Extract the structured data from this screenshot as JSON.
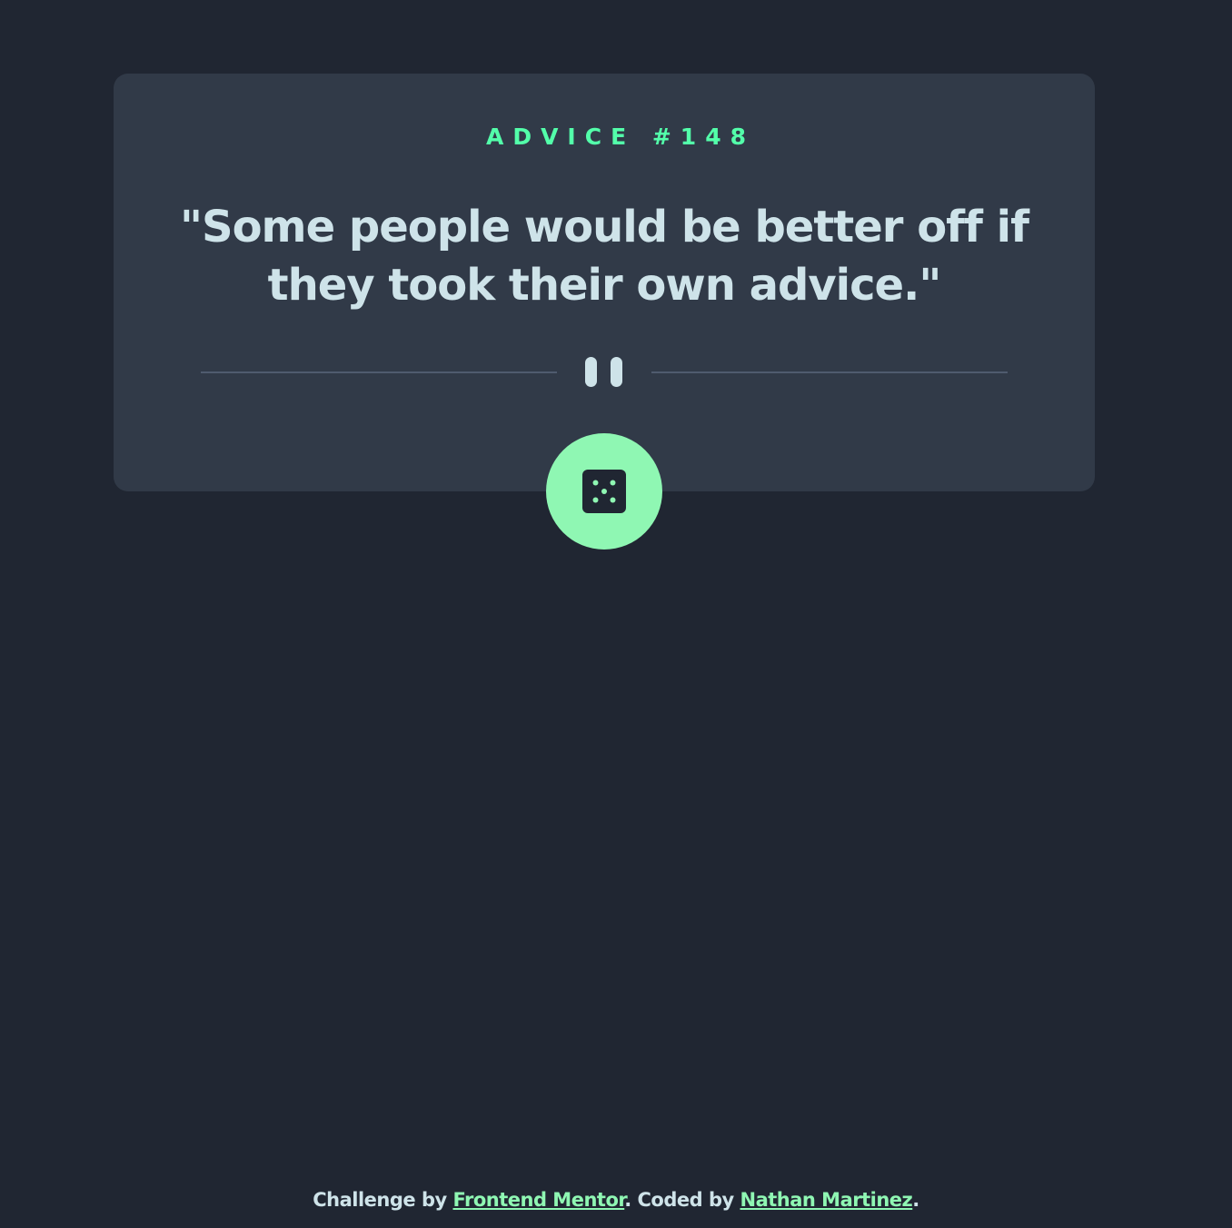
{
  "card": {
    "advice_label": "ADVICE #148",
    "quote": "\"Some people would be better off if they took their own advice.\""
  },
  "divider": {
    "icon": "pause-icon"
  },
  "dice_button": {
    "icon": "dice-icon",
    "aria_label": "Get new advice"
  },
  "footer": {
    "prefix": "Challenge by ",
    "challenge_link": "Frontend Mentor",
    "middle": ". Coded by ",
    "author_link": "Nathan Martinez",
    "suffix": "."
  },
  "colors": {
    "background": "#202632",
    "card": "#313a48",
    "accent": "#53ffaa",
    "button": "#8ff7b3",
    "text": "#cee3e9",
    "divider": "#4f5b6e"
  }
}
